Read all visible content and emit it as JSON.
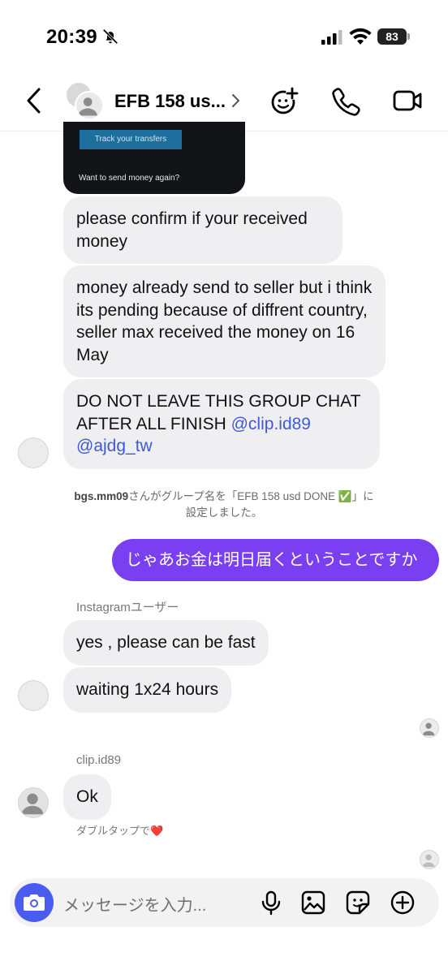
{
  "status_bar": {
    "time": "20:39",
    "battery": "83"
  },
  "header": {
    "title": "EFB 158 us..."
  },
  "image_message": {
    "button_label": "Track your transfers",
    "caption": "Want to send money again?"
  },
  "messages": {
    "m1": "please confirm if your received money",
    "m2": "money already send to seller but i think its pending because of diffrent country, seller max received the money on 16 May",
    "m3_text": "DO NOT LEAVE THIS GROUP CHAT AFTER ALL FINISH",
    "m3_mention1": "@clip.id89",
    "m3_mention2": "@ajdg_tw",
    "system_user": "bgs.mm09",
    "system_line1": "さんがグループ名を「EFB 158 usd DONE ✅」に",
    "system_line2": "設定しました。",
    "sent1": "じゃあお金は明日届くということですか",
    "sender2": "Instagramユーザー",
    "m4": "yes , please can be fast",
    "m5": "waiting 1x24 hours",
    "sender3": "clip.id89",
    "m6": "Ok",
    "double_tap": "ダブルタップで❤️"
  },
  "composer": {
    "placeholder": "メッセージを入力..."
  },
  "colors": {
    "accent": "#7b3ff2",
    "mention": "#3e58d9",
    "camera": "#4a5cf0"
  },
  "icons": [
    "bell-slash-icon",
    "signal-icon",
    "wifi-icon",
    "battery-icon",
    "back-chevron-icon",
    "chevron-right-icon",
    "add-people-icon",
    "phone-icon",
    "video-icon",
    "camera-icon",
    "microphone-icon",
    "gallery-icon",
    "sticker-icon",
    "add-icon"
  ]
}
